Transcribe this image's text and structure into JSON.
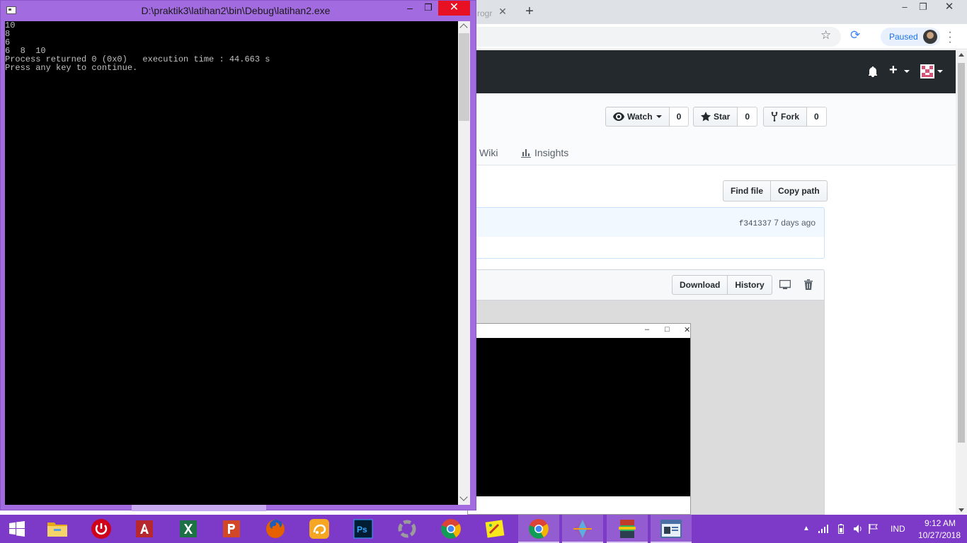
{
  "browser": {
    "partial_tab_text": "rogr",
    "tab_close": "✕",
    "new_tab": "+",
    "window_controls": {
      "minimize": "–",
      "maximize": "❐",
      "close": "✕"
    },
    "toolbar": {
      "profile_status": "Paused"
    },
    "github": {
      "watch": {
        "label": "Watch",
        "count": "0"
      },
      "star": {
        "label": "Star",
        "count": "0"
      },
      "fork": {
        "label": "Fork",
        "count": "0"
      },
      "tabs": {
        "wiki": "Wiki",
        "insights": "Insights"
      },
      "file_nav": {
        "find_file": "Find file",
        "copy_path": "Copy path"
      },
      "commit": {
        "sha": "f341337",
        "age": "7 days ago"
      },
      "file_actions": {
        "download": "Download",
        "history": "History"
      }
    },
    "embedded_window_controls": {
      "minimize": "–",
      "maximize": "□",
      "close": "✕"
    }
  },
  "console": {
    "title": "D:\\praktik3\\latihan2\\bin\\Debug\\latihan2.exe",
    "controls": {
      "minimize": "–",
      "maximize": "❐",
      "close": "✕"
    },
    "output": "10\n8\n6\n6  8  10\nProcess returned 0 (0x0)   execution time : 44.663 s\nPress any key to continue."
  },
  "taskbar": {
    "apps": [
      {
        "name": "file-explorer",
        "color": "#f2c94c"
      },
      {
        "name": "shutdown",
        "color": "#d0021b"
      },
      {
        "name": "access",
        "color": "#b7282e"
      },
      {
        "name": "excel",
        "color": "#1e7145"
      },
      {
        "name": "powerpoint",
        "color": "#d24726"
      },
      {
        "name": "firefox",
        "color": "#e66000"
      },
      {
        "name": "uc-browser",
        "color": "#f5a623"
      },
      {
        "name": "photoshop",
        "color": "#001d34"
      },
      {
        "name": "loader",
        "color": "#9b9b9b"
      },
      {
        "name": "chrome",
        "color": "#4285f4"
      },
      {
        "name": "paint",
        "color": "#f8e71c"
      },
      {
        "name": "chrome-active",
        "color": "#4285f4"
      },
      {
        "name": "gem-app",
        "color": "#9b59b6"
      },
      {
        "name": "winrar",
        "color": "#7b1fa2"
      },
      {
        "name": "console-app",
        "color": "#4a6fa5"
      }
    ],
    "language": "IND",
    "time": "9:12 AM",
    "date": "10/27/2018"
  }
}
